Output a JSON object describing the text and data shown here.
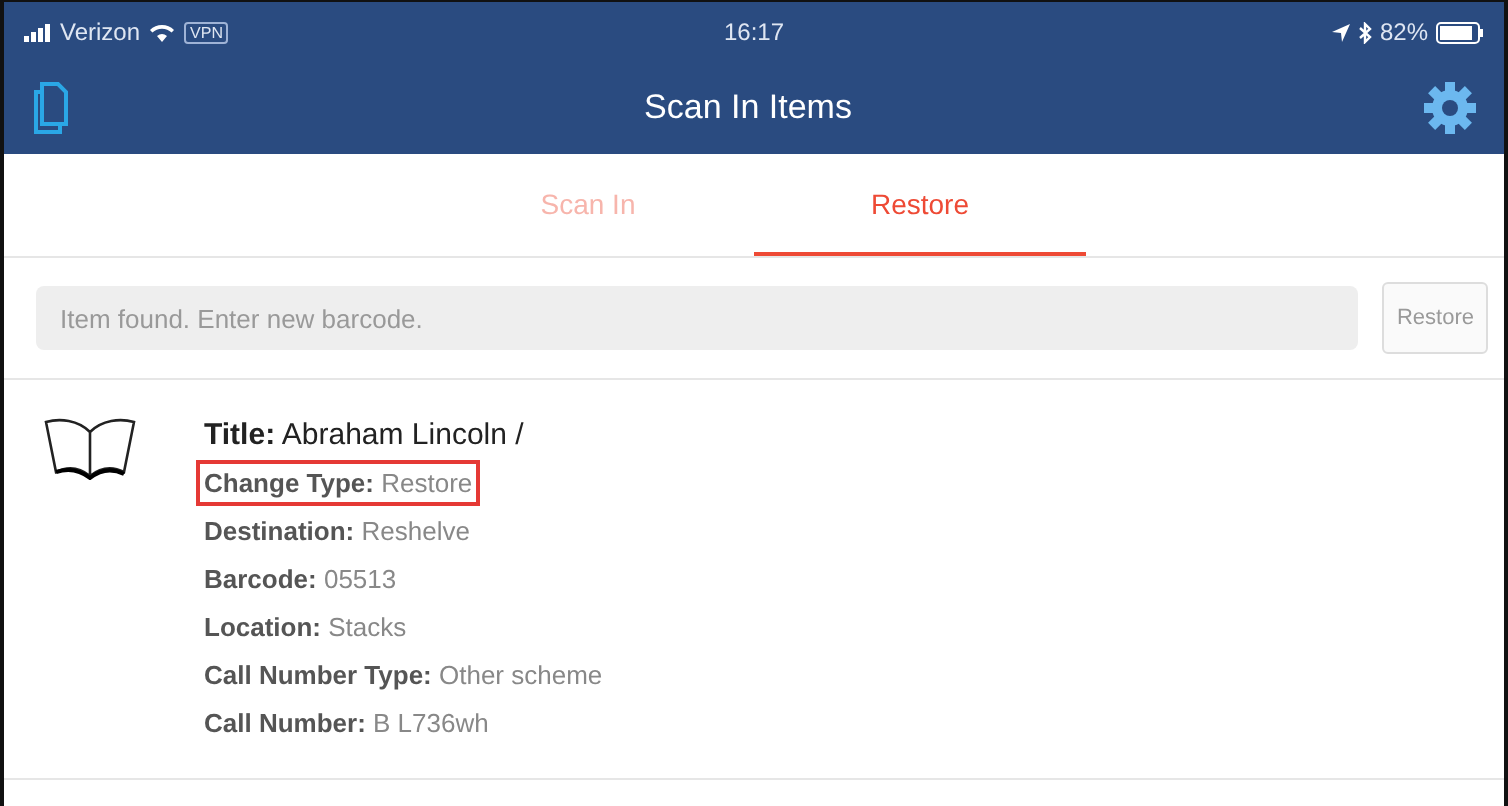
{
  "status_bar": {
    "carrier": "Verizon",
    "vpn": "VPN",
    "time": "16:17",
    "battery": "82%"
  },
  "nav": {
    "title": "Scan In Items"
  },
  "tabs": [
    {
      "label": "Scan In",
      "selected": false
    },
    {
      "label": "Restore",
      "selected": true
    }
  ],
  "barcode_field": {
    "placeholder": "Item found. Enter new barcode."
  },
  "action_button": {
    "label": "Restore",
    "disabled": true
  },
  "item": {
    "fields": [
      {
        "text": "**Title:** Abraham Lincoln /",
        "kind": "title",
        "highlighted": false
      },
      {
        "text": "**Change Type:** Restore",
        "kind": "detail",
        "highlighted": true
      },
      {
        "text": "**Destination:** Reshelve",
        "kind": "detail",
        "highlighted": false
      },
      {
        "text": "**Barcode:** 05513",
        "kind": "detail",
        "highlighted": false
      },
      {
        "text": "**Location:** Stacks",
        "kind": "detail",
        "highlighted": false
      },
      {
        "text": "**Call Number Type:** Other scheme",
        "kind": "detail",
        "highlighted": false
      },
      {
        "text": "**Call Number:** B L736wh",
        "kind": "detail",
        "highlighted": false
      }
    ]
  }
}
